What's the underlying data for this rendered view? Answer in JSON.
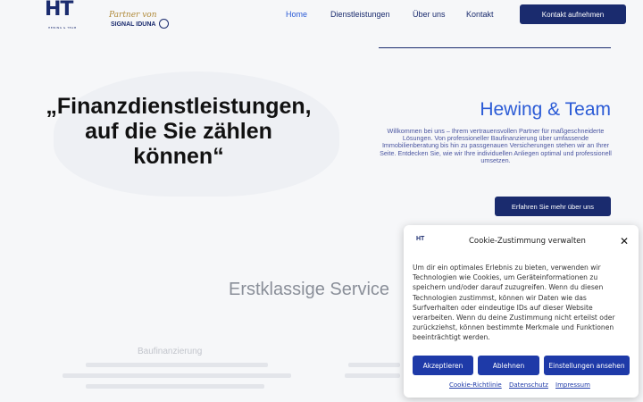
{
  "header": {
    "logo_text": "HT",
    "logo_sub": "HEWING & TEAM",
    "partner_script": "Partner von",
    "partner_name": "SIGNAL IDUNA",
    "nav": [
      "Home",
      "Dienstleistungen",
      "Über uns",
      "Kontakt"
    ],
    "cta": "Kontakt aufnehmen"
  },
  "hero": {
    "quote_line1": "„Finanzdienstleistungen,",
    "quote_line2": "auf die Sie zählen",
    "quote_line3": "können“",
    "title": "Hewing & Team",
    "text": "Willkommen bei uns – Ihrem vertrauensvollen Partner für maßgeschneiderte Lösungen. Von professioneller Baufinanzierung über umfassende Immobilienberatung bis hin zu passgenauen Versicherungen stehen wir an Ihrer Seite. Entdecken Sie, wie wir Ihre individuellen Anliegen optimal und professionell umsetzen.",
    "button": "Erfahren Sie mehr über uns"
  },
  "services": {
    "title": "Erstklassige Service",
    "first_label": "Baufinanzierung"
  },
  "cookie": {
    "logo": "HT",
    "title": "Cookie-Zustimmung verwalten",
    "body": "Um dir ein optimales Erlebnis zu bieten, verwenden wir Technologien wie Cookies, um Geräteinformationen zu speichern und/oder darauf zuzugreifen. Wenn du diesen Technologien zustimmst, können wir Daten wie das Surfverhalten oder eindeutige IDs auf dieser Website verarbeiten. Wenn du deine Zustimmung nicht erteilst oder zurückziehst, können bestimmte Merkmale und Funktionen beeinträchtigt werden.",
    "accept": "Akzeptieren",
    "deny": "Ablehnen",
    "settings": "Einstellungen ansehen",
    "links": [
      "Cookie-Richtlinie",
      "Datenschutz",
      "Impressum"
    ]
  },
  "colors": {
    "brand": "#1a2b6e",
    "accent": "#2b5bd6",
    "cookie_button": "#1e3aa8"
  }
}
